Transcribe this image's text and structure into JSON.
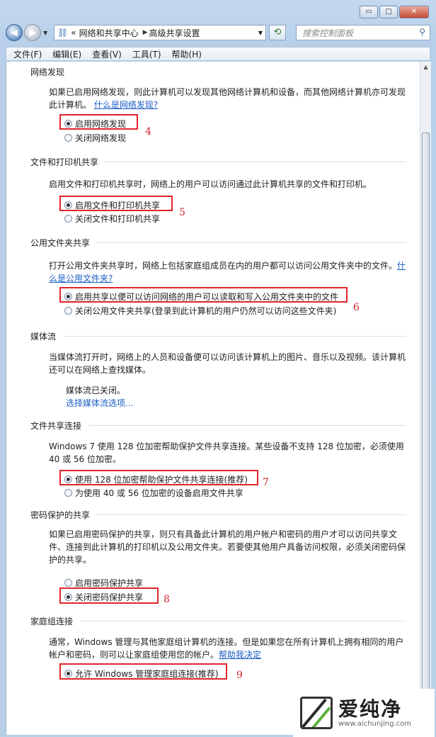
{
  "window": {
    "minimize_glyph": "▭",
    "maximize_glyph": "□",
    "close_glyph": "✕"
  },
  "nav": {
    "breadcrumb_prefix": "«",
    "crumbs": [
      "网络和共享中心",
      "高级共享设置"
    ],
    "search_placeholder": "搜索控制面板"
  },
  "menu": [
    "文件(F)",
    "编辑(E)",
    "查看(V)",
    "工具(T)",
    "帮助(H)"
  ],
  "sections": {
    "network_discovery": {
      "title": "网络发现",
      "desc1": "如果已启用网络发现，则此计算机可以发现其他网络计算机和设备，而其他网络计算机亦可发现",
      "desc2": "此计算机。",
      "link": "什么是网络发现?",
      "opt_on": "启用网络发现",
      "opt_off": "关闭网络发现",
      "marker": "4"
    },
    "file_printer": {
      "title": "文件和打印机共享",
      "desc": "启用文件和打印机共享时，网络上的用户可以访问通过此计算机共享的文件和打印机。",
      "opt_on": "启用文件和打印机共享",
      "opt_off": "关闭文件和打印机共享",
      "marker": "5"
    },
    "public_folder": {
      "title": "公用文件夹共享",
      "desc1": "打开公用文件夹共享时，网络上包括家庭组成员在内的用户都可以访问公用文件夹中的文件。",
      "link1": "什",
      "link2": "么是公用文件夹?",
      "opt_on": "启用共享以便可以访问网络的用户可以读取和写入公用文件夹中的文件",
      "opt_off": "关闭公用文件夹共享(登录到此计算机的用户仍然可以访问这些文件夹)",
      "marker": "6"
    },
    "media": {
      "title": "媒体流",
      "desc1": "当媒体流打开时，网络上的人员和设备便可以访问该计算机上的图片、音乐以及视频。该计算机",
      "desc2": "还可以在网络上查找媒体。",
      "status": "媒体流已关闭。",
      "link": "选择媒体流选项..."
    },
    "file_sharing": {
      "title": "文件共享连接",
      "desc1": "Windows 7 使用 128 位加密帮助保护文件共享连接。某些设备不支持 128 位加密，必须使用",
      "desc2": "40 或 56 位加密。",
      "opt_on": "使用 128 位加密帮助保护文件共享连接(推荐)",
      "opt_off": "为使用 40 或 56 位加密的设备启用文件共享",
      "marker": "7"
    },
    "password": {
      "title": "密码保护的共享",
      "desc1": "如果已启用密码保护的共享，则只有具备此计算机的用户帐户和密码的用户才可以访问共享文",
      "desc2": "件、连接到此计算机的打印机以及公用文件夹。若要使其他用户具备访问权限，必须关闭密码保",
      "desc3": "护的共享。",
      "opt_on": "启用密码保护共享",
      "opt_off": "关闭密码保护共享",
      "marker": "8"
    },
    "homegroup": {
      "title": "家庭组连接",
      "desc1": "通常，Windows 管理与其他家庭组计算机的连接。但是如果您在所有计算机上拥有相同的用户",
      "desc2": "帐户和密码，则可以让家庭组使用您的帐户。",
      "link": "帮助我决定",
      "opt_on": "允许 Windows 管理家庭组连接(推荐)",
      "marker": "9"
    }
  },
  "watermark": {
    "brand": "爱纯净",
    "url": "www.aichunjing.com"
  }
}
